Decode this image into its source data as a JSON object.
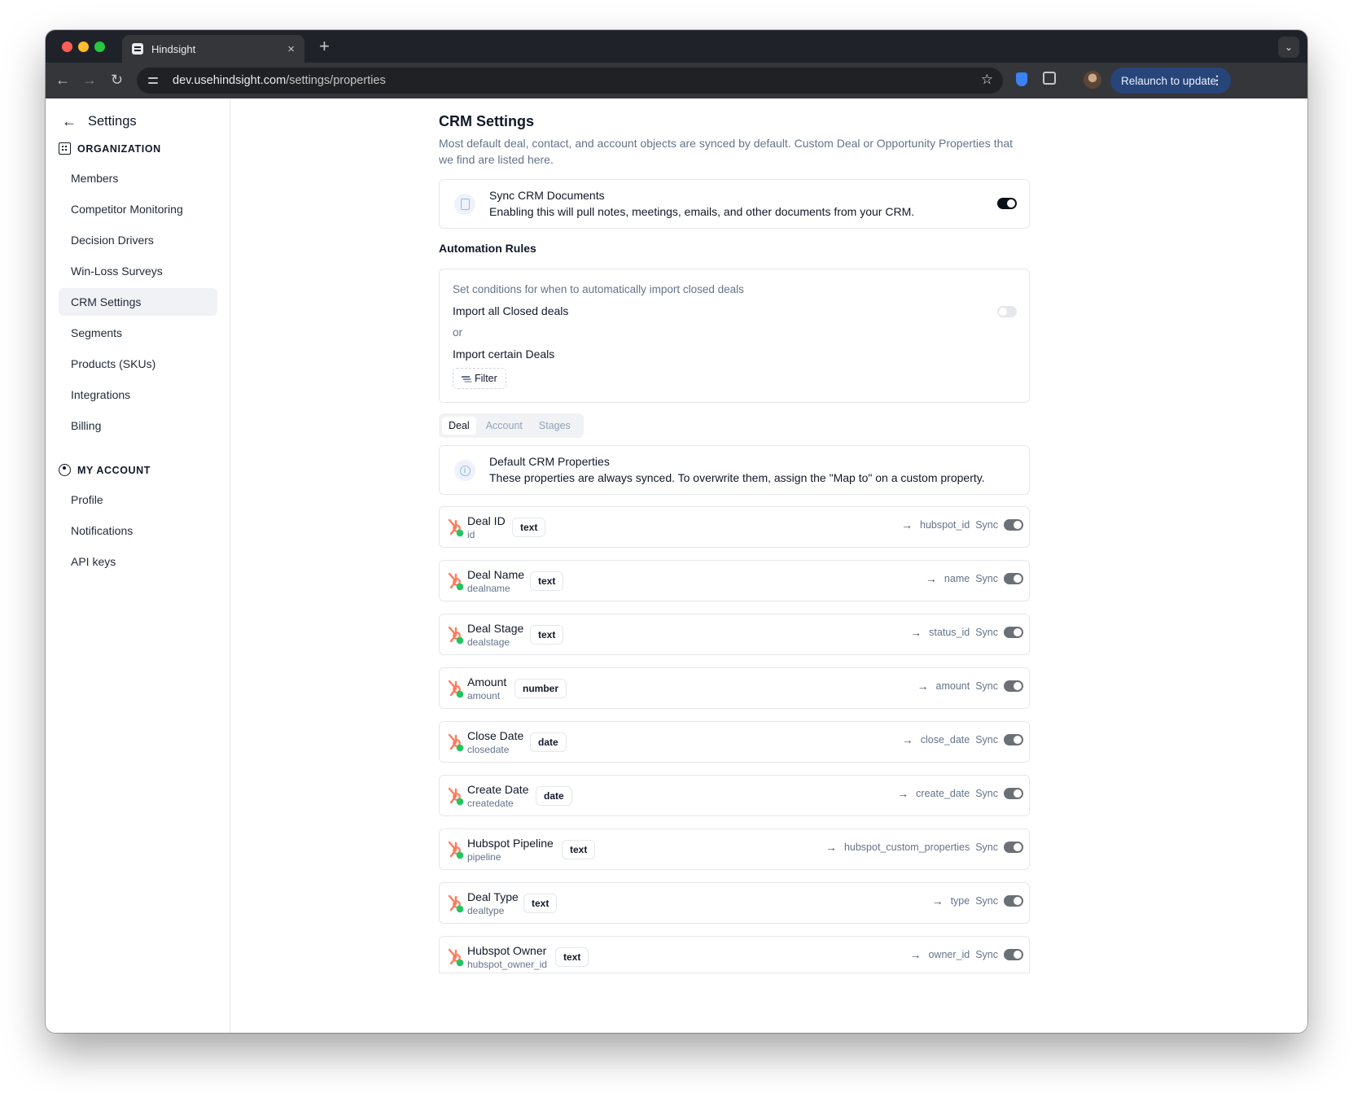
{
  "browser": {
    "tab_title": "Hindsight",
    "tab_close": "×",
    "new_tab": "+",
    "url_host": "dev.usehindsight.com",
    "url_path": "/settings/properties",
    "relaunch_label": "Relaunch to update"
  },
  "sidebar": {
    "back_label": "Settings",
    "org_heading": "ORGANIZATION",
    "org_items": [
      "Members",
      "Competitor Monitoring",
      "Decision Drivers",
      "Win-Loss Surveys",
      "CRM Settings",
      "Segments",
      "Products (SKUs)",
      "Integrations",
      "Billing"
    ],
    "active_item": "CRM Settings",
    "account_heading": "MY ACCOUNT",
    "account_items": [
      "Profile",
      "Notifications",
      "API keys"
    ]
  },
  "main": {
    "title": "CRM Settings",
    "description": "Most default deal, contact, and account objects are synced by default. Custom Deal or Opportunity Properties that we find are listed here.",
    "sync_docs": {
      "title": "Sync CRM Documents",
      "subtitle": "Enabling this will pull notes, meetings, emails, and other documents from your CRM.",
      "enabled": true
    },
    "automation": {
      "heading": "Automation Rules",
      "description": "Set conditions for when to automatically import closed deals",
      "import_all_label": "Import all Closed deals",
      "import_all_enabled": false,
      "or_label": "or",
      "import_certain_label": "Import certain Deals",
      "filter_label": "Filter"
    },
    "tabs": [
      "Deal",
      "Account",
      "Stages"
    ],
    "active_tab": "Deal",
    "defaults_card": {
      "title": "Default CRM Properties",
      "subtitle": "These properties are always synced. To overwrite them, assign the \"Map to\" on a custom property."
    },
    "sync_label": "Sync",
    "properties": [
      {
        "name": "Deal ID",
        "key": "id",
        "type": "text",
        "map_to": "hubspot_id"
      },
      {
        "name": "Deal Name",
        "key": "dealname",
        "type": "text",
        "map_to": "name"
      },
      {
        "name": "Deal Stage",
        "key": "dealstage",
        "type": "text",
        "map_to": "status_id"
      },
      {
        "name": "Amount",
        "key": "amount",
        "type": "number",
        "map_to": "amount"
      },
      {
        "name": "Close Date",
        "key": "closedate",
        "type": "date",
        "map_to": "close_date"
      },
      {
        "name": "Create Date",
        "key": "createdate",
        "type": "date",
        "map_to": "create_date"
      },
      {
        "name": "Hubspot Pipeline",
        "key": "pipeline",
        "type": "text",
        "map_to": "hubspot_custom_properties"
      },
      {
        "name": "Deal Type",
        "key": "dealtype",
        "type": "text",
        "map_to": "type"
      },
      {
        "name": "Hubspot Owner",
        "key": "hubspot_owner_id",
        "type": "text",
        "map_to": "owner_id"
      }
    ]
  },
  "colors": {
    "hubspot_orange": "#ff7a59",
    "hubspot_green": "#22c55e",
    "toggle_on": "#0b0f19",
    "toggle_locked": "#6b6f76"
  }
}
